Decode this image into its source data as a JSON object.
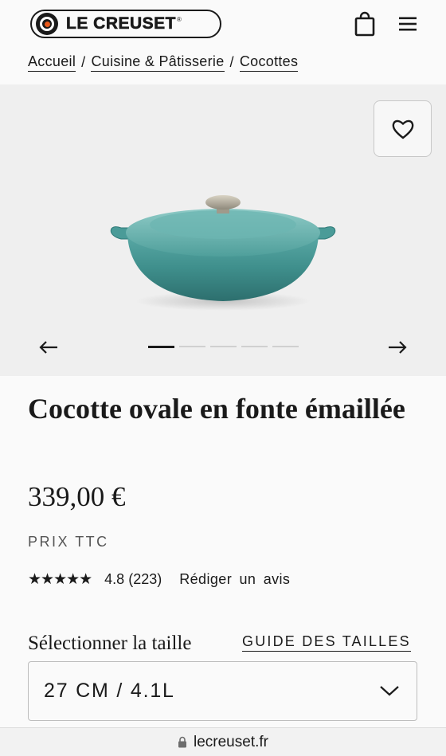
{
  "header": {
    "brand": "LE CREUSET",
    "brand_mark": "®",
    "icons": {
      "logo": "le-creuset-logo-icon",
      "bag": "shopping-bag-icon",
      "menu": "menu-icon"
    }
  },
  "breadcrumb": {
    "items": [
      {
        "label": "Accueil"
      },
      {
        "label": "Cuisine & Pâtisserie"
      },
      {
        "label": "Cocottes"
      }
    ],
    "separator": "/"
  },
  "gallery": {
    "slide_count": 5,
    "active_slide": 1,
    "icons": {
      "wishlist": "heart-icon",
      "prev": "arrow-left-icon",
      "next": "arrow-right-icon"
    },
    "product_color": "#3f8f8c"
  },
  "product": {
    "title": "Cocotte ovale en fonte émaillée",
    "price": "339,00 €",
    "tax_note": "PRIX TTC",
    "rating": {
      "stars": 5,
      "stars_display": "★★★★★",
      "value": "4.8",
      "count": "(223)",
      "review_link": "Rédiger un avis"
    }
  },
  "size": {
    "label": "Sélectionner la taille",
    "guide_link": "GUIDE DES TAILLES",
    "selected": "27 CM / 4.1L",
    "dropdown_icon": "chevron-down-icon"
  },
  "browser": {
    "url": "lecreuset.fr",
    "icon": "lock-icon"
  }
}
